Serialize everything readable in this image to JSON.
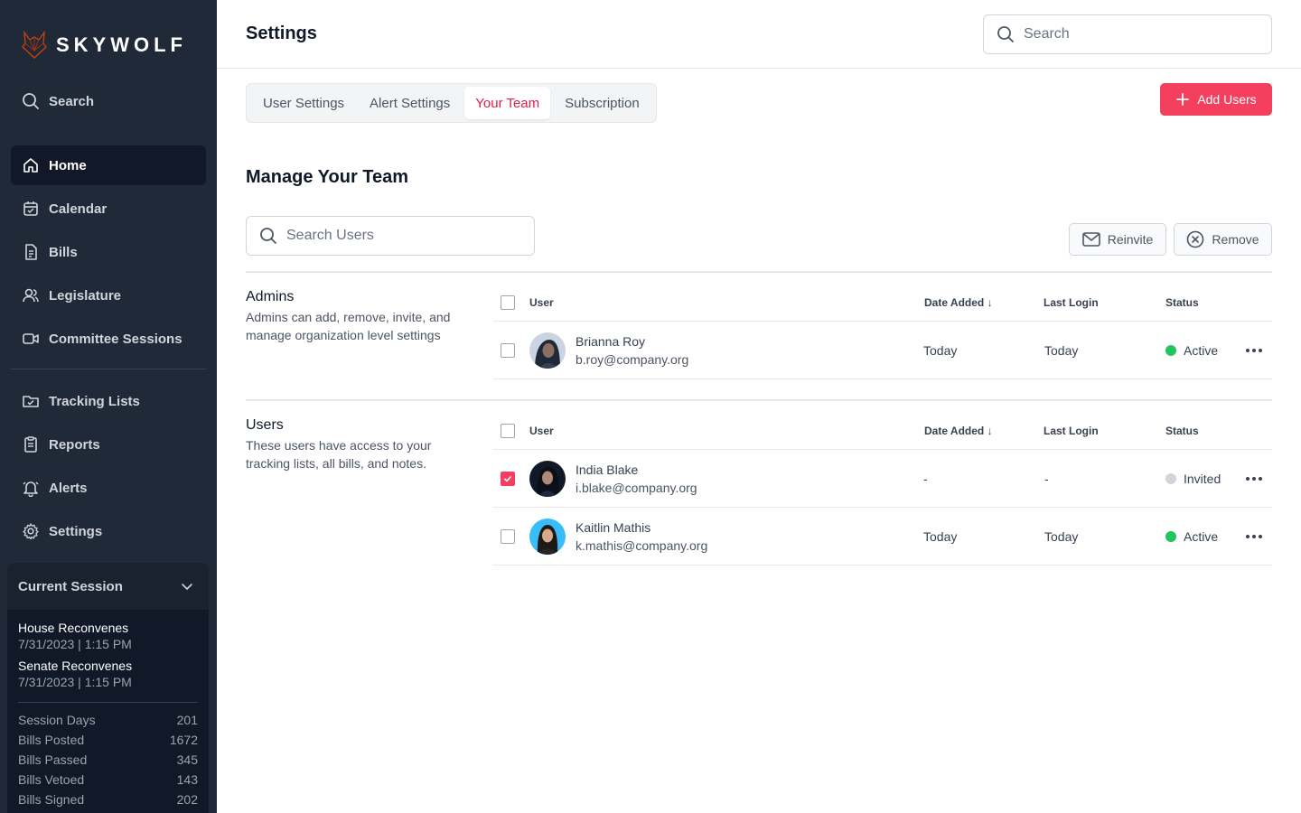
{
  "brand": {
    "name": "SKYWOLF"
  },
  "sidebar": {
    "search_label": "Search",
    "primary_items": [
      {
        "label": "Home",
        "icon": "home-icon",
        "active": true
      },
      {
        "label": "Calendar",
        "icon": "calendar-icon"
      },
      {
        "label": "Bills",
        "icon": "document-icon"
      },
      {
        "label": "Legislature",
        "icon": "users-icon"
      },
      {
        "label": "Committee Sessions",
        "icon": "video-icon"
      }
    ],
    "secondary_items": [
      {
        "label": "Tracking Lists",
        "icon": "folder-check-icon"
      },
      {
        "label": "Reports",
        "icon": "report-icon"
      },
      {
        "label": "Alerts",
        "icon": "bell-icon"
      },
      {
        "label": "Settings",
        "icon": "gear-icon"
      }
    ],
    "session": {
      "title": "Current Session",
      "events": [
        {
          "title": "House Reconvenes",
          "date": "7/31/2023 | 1:15 PM"
        },
        {
          "title": "Senate Reconvenes",
          "date": "7/31/2023 | 1:15 PM"
        }
      ],
      "stats": [
        {
          "label": "Session Days",
          "value": "201"
        },
        {
          "label": "Bills Posted",
          "value": "1672"
        },
        {
          "label": "Bills Passed",
          "value": "345"
        },
        {
          "label": "Bills Vetoed",
          "value": "143"
        },
        {
          "label": "Bills Signed",
          "value": "202"
        }
      ]
    }
  },
  "header": {
    "title": "Settings",
    "search_placeholder": "Search"
  },
  "tabs": [
    {
      "label": "User Settings"
    },
    {
      "label": "Alert Settings"
    },
    {
      "label": "Your Team",
      "active": true
    },
    {
      "label": "Subscription"
    }
  ],
  "actions": {
    "add_users": "Add Users",
    "reinvite": "Reinvite",
    "remove": "Remove"
  },
  "team": {
    "title": "Manage Your Team",
    "search_placeholder": "Search Users",
    "columns": {
      "user": "User",
      "date_added": "Date Added ↓",
      "last_login": "Last Login",
      "status": "Status"
    },
    "groups": [
      {
        "name": "Admins",
        "description": "Admins can add, remove, invite, and manage organization level settings",
        "members": [
          {
            "name": "Brianna Roy",
            "email": "b.roy@company.org",
            "date_added": "Today",
            "last_login": "Today",
            "status": "Active",
            "status_color": "#22c55e",
            "checked": false
          }
        ]
      },
      {
        "name": "Users",
        "description": "These users have access to your tracking lists, all bills, and notes.",
        "members": [
          {
            "name": "India Blake",
            "email": "i.blake@company.org",
            "date_added": "-",
            "last_login": "-",
            "status": "Invited",
            "status_color": "#d1d5db",
            "checked": true
          },
          {
            "name": "Kaitlin Mathis",
            "email": "k.mathis@company.org",
            "date_added": "Today",
            "last_login": "Today",
            "status": "Active",
            "status_color": "#22c55e",
            "checked": false
          }
        ]
      }
    ]
  },
  "colors": {
    "accent": "#f43f5e",
    "sidebar_bg": "#1f2937",
    "active": "#22c55e",
    "invited": "#d1d5db"
  }
}
